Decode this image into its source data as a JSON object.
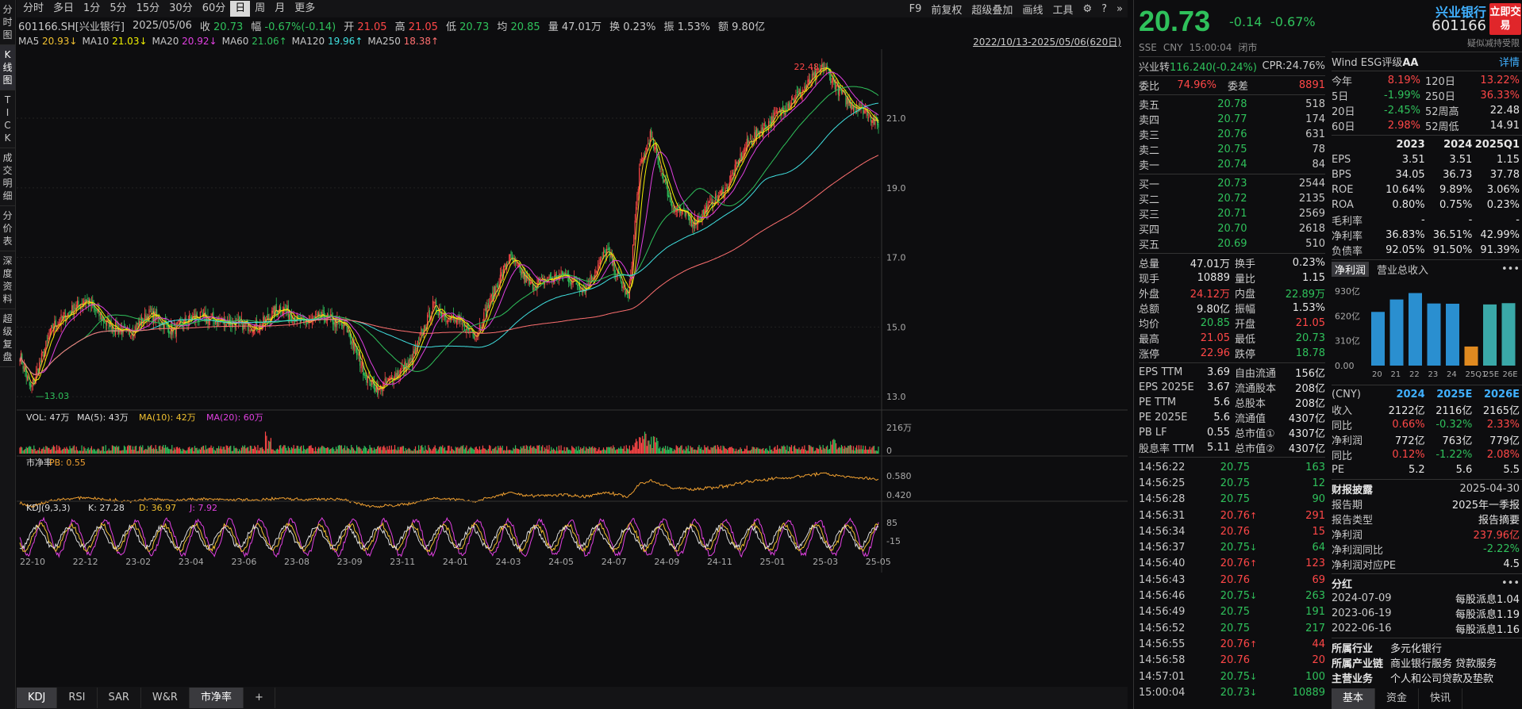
{
  "sidebar": [
    {
      "label": "分时图",
      "chars": [
        "分",
        "时",
        "图"
      ]
    },
    {
      "label": "K线图",
      "chars": [
        "K",
        "线",
        "图"
      ],
      "active": true
    },
    {
      "label": "TICK",
      "chars": [
        "T",
        "I",
        "C",
        "K"
      ]
    },
    {
      "label": "成交明细",
      "chars": [
        "成",
        "交",
        "明",
        "细"
      ]
    },
    {
      "label": "分价表",
      "chars": [
        "分",
        "价",
        "表"
      ]
    },
    {
      "label": "深度资料",
      "chars": [
        "深",
        "度",
        "资",
        "料"
      ]
    },
    {
      "label": "超级复盘",
      "chars": [
        "超",
        "级",
        "复",
        "盘"
      ]
    }
  ],
  "toolbar": {
    "timeframes": [
      "分时",
      "多日",
      "1分",
      "5分",
      "15分",
      "30分",
      "60分",
      "日",
      "周",
      "月",
      "更多"
    ],
    "active_timeframe": "日",
    "right_items": [
      "F9",
      "前复权",
      "超级叠加",
      "画线",
      "工具"
    ]
  },
  "info": {
    "code": "601166.SH[兴业银行]",
    "date": "2025/05/06",
    "close_label": "收",
    "close": "20.73",
    "chg_label": "幅",
    "chg": "-0.67%(-0.14)",
    "open_label": "开",
    "open": "21.05",
    "high_label": "高",
    "high": "21.05",
    "low_label": "低",
    "low": "20.73",
    "avg_label": "均",
    "avg": "20.85",
    "vol_label": "量",
    "vol": "47.01万",
    "turn_label": "换",
    "turn": "0.23%",
    "amp_label": "振",
    "amp": "1.53%",
    "amt_label": "额",
    "amt": "9.80亿"
  },
  "ma": {
    "items": [
      {
        "label": "MA5",
        "value": "20.93↓",
        "color": "#f0c030"
      },
      {
        "label": "MA10",
        "value": "21.03↓",
        "color": "#f0f000"
      },
      {
        "label": "MA20",
        "value": "20.92↓",
        "color": "#e040e0"
      },
      {
        "label": "MA60",
        "value": "21.06↑",
        "color": "#2fc15b"
      },
      {
        "label": "MA120",
        "value": "19.96↑",
        "color": "#40e0e0"
      },
      {
        "label": "MA250",
        "value": "18.38↑",
        "color": "#ff7070"
      }
    ],
    "date_range": "2022/10/13-2025/05/06(620日)"
  },
  "chart_data": [
    {
      "type": "candlestick",
      "panel": "price",
      "y_ticks": [
        "21.0",
        "19.0",
        "17.0",
        "15.0",
        "13.0"
      ],
      "ylim": [
        12.8,
        22.8
      ],
      "max_label": "22.48",
      "min_label": "13.03",
      "x_ticks": [
        "22-10",
        "22-12",
        "23-02",
        "23-04",
        "23-06",
        "23-08",
        "23-09",
        "23-11",
        "24-01",
        "24-03",
        "24-05",
        "24-07",
        "24-09",
        "24-11",
        "25-01",
        "25-03",
        "25-05"
      ],
      "close_keypoints": [
        [
          0,
          14.2
        ],
        [
          10,
          13.2
        ],
        [
          30,
          15.0
        ],
        [
          60,
          15.8
        ],
        [
          80,
          15.1
        ],
        [
          100,
          14.8
        ],
        [
          120,
          15.4
        ],
        [
          140,
          14.9
        ],
        [
          160,
          15.3
        ],
        [
          180,
          15.2
        ],
        [
          200,
          15.1
        ],
        [
          220,
          15.0
        ],
        [
          240,
          15.6
        ],
        [
          260,
          15.1
        ],
        [
          280,
          15.3
        ],
        [
          300,
          15.0
        ],
        [
          320,
          13.5
        ],
        [
          330,
          13.2
        ],
        [
          360,
          14.0
        ],
        [
          380,
          15.6
        ],
        [
          400,
          15.2
        ],
        [
          420,
          14.8
        ],
        [
          450,
          17.0
        ],
        [
          470,
          16.2
        ],
        [
          500,
          16.5
        ],
        [
          520,
          16.1
        ],
        [
          540,
          17.2
        ],
        [
          560,
          15.8
        ],
        [
          570,
          19.5
        ],
        [
          580,
          20.5
        ],
        [
          600,
          18.5
        ],
        [
          620,
          18.0
        ],
        [
          650,
          19.0
        ],
        [
          670,
          20.3
        ],
        [
          700,
          21.2
        ],
        [
          720,
          21.8
        ],
        [
          740,
          22.48
        ],
        [
          760,
          21.5
        ],
        [
          780,
          21.2
        ],
        [
          790,
          20.73
        ]
      ]
    },
    {
      "type": "bar",
      "panel": "volume",
      "label": "VOL: 47万",
      "ma5": "MA(5): 43万",
      "ma10": "MA(10): 42万",
      "ma20": "MA(20): 60万",
      "y_ticks": [
        "216万",
        "0"
      ]
    },
    {
      "type": "line",
      "panel": "pb",
      "label": "市净率",
      "pb": "PB: 0.55",
      "y_ticks": [
        "0.580",
        "0.420"
      ]
    },
    {
      "type": "line",
      "panel": "kdj",
      "label": "KDJ(9,3,3)",
      "k": "K: 27.28",
      "d": "D: 36.97",
      "j": "J: 7.92",
      "y_ticks": [
        "85",
        "-15"
      ]
    }
  ],
  "bottom_tabs": [
    "KDJ",
    "RSI",
    "SAR",
    "W&R",
    "市净率",
    "+"
  ],
  "quote": {
    "price": "20.73",
    "change": "-0.14",
    "pct": "-0.67%",
    "name": "兴业银行",
    "code": "601166",
    "trade_btn": "立即交易",
    "exch": "SSE",
    "ccy": "CNY",
    "time": "15:00:04",
    "status": "闭市",
    "tags": "疑似减持受限",
    "conv_bond": "兴业转",
    "conv_val": "116.240(-0.24%)",
    "cpr": "CPR:24.76%",
    "webi_label": "委比",
    "webi": "74.96%",
    "wecha_label": "委差",
    "wecha": "8891",
    "asks": [
      {
        "label": "卖五",
        "price": "20.78",
        "vol": "518"
      },
      {
        "label": "卖四",
        "price": "20.77",
        "vol": "174"
      },
      {
        "label": "卖三",
        "price": "20.76",
        "vol": "631"
      },
      {
        "label": "卖二",
        "price": "20.75",
        "vol": "78"
      },
      {
        "label": "卖一",
        "price": "20.74",
        "vol": "84"
      }
    ],
    "bids": [
      {
        "label": "买一",
        "price": "20.73",
        "vol": "2544"
      },
      {
        "label": "买二",
        "price": "20.72",
        "vol": "2135"
      },
      {
        "label": "买三",
        "price": "20.71",
        "vol": "2569"
      },
      {
        "label": "买四",
        "price": "20.70",
        "vol": "2618"
      },
      {
        "label": "买五",
        "price": "20.69",
        "vol": "510"
      }
    ],
    "stats": [
      [
        "总量",
        "47.01万",
        "换手",
        "0.23%"
      ],
      [
        "现手",
        "10889",
        "量比",
        "1.15"
      ],
      [
        "外盘",
        "24.12万",
        "内盘",
        "22.89万"
      ],
      [
        "总额",
        "9.80亿",
        "振幅",
        "1.53%"
      ],
      [
        "均价",
        "20.85",
        "开盘",
        "21.05"
      ],
      [
        "最高",
        "21.05",
        "最低",
        "20.73"
      ],
      [
        "涨停",
        "22.96",
        "跌停",
        "18.78"
      ]
    ],
    "fund": [
      [
        "EPS TTM",
        "3.69",
        "自由流通",
        "156亿"
      ],
      [
        "EPS 2025E",
        "3.67",
        "流通股本",
        "208亿"
      ],
      [
        "PE TTM",
        "5.6",
        "总股本",
        "208亿"
      ],
      [
        "PE 2025E",
        "5.6",
        "流通值",
        "4307亿"
      ],
      [
        "PB LF",
        "0.55",
        "总市值①",
        "4307亿"
      ],
      [
        "股息率 TTM",
        "5.11",
        "总市值②",
        "4307亿"
      ]
    ],
    "ticks": [
      {
        "time": "14:56:22",
        "price": "20.75",
        "dir": "",
        "vol": "163",
        "c": "dn"
      },
      {
        "time": "14:56:25",
        "price": "20.75",
        "dir": "",
        "vol": "12",
        "c": "dn"
      },
      {
        "time": "14:56:28",
        "price": "20.75",
        "dir": "",
        "vol": "90",
        "c": "dn"
      },
      {
        "time": "14:56:31",
        "price": "20.76",
        "dir": "↑",
        "vol": "291",
        "c": "up"
      },
      {
        "time": "14:56:34",
        "price": "20.76",
        "dir": "",
        "vol": "15",
        "c": "up"
      },
      {
        "time": "14:56:37",
        "price": "20.75",
        "dir": "↓",
        "vol": "64",
        "c": "dn"
      },
      {
        "time": "14:56:40",
        "price": "20.76",
        "dir": "↑",
        "vol": "123",
        "c": "up"
      },
      {
        "time": "14:56:43",
        "price": "20.76",
        "dir": "",
        "vol": "69",
        "c": "up"
      },
      {
        "time": "14:56:46",
        "price": "20.75",
        "dir": "↓",
        "vol": "263",
        "c": "dn"
      },
      {
        "time": "14:56:49",
        "price": "20.75",
        "dir": "",
        "vol": "191",
        "c": "dn"
      },
      {
        "time": "14:56:52",
        "price": "20.75",
        "dir": "",
        "vol": "217",
        "c": "dn"
      },
      {
        "time": "14:56:55",
        "price": "20.76",
        "dir": "↑",
        "vol": "44",
        "c": "up"
      },
      {
        "time": "14:56:58",
        "price": "20.76",
        "dir": "",
        "vol": "20",
        "c": "up"
      },
      {
        "time": "14:57:01",
        "price": "20.75",
        "dir": "↓",
        "vol": "100",
        "c": "dn"
      },
      {
        "time": "15:00:04",
        "price": "20.73",
        "dir": "↓",
        "vol": "10889",
        "c": "dn"
      }
    ]
  },
  "f10": {
    "wind_esg": "Wind ESG评级",
    "esg_grade": "AA",
    "detail": "详情",
    "returns": [
      [
        "今年",
        "8.19%",
        "120日",
        "13.22%"
      ],
      [
        "5日",
        "-1.99%",
        "250日",
        "36.33%"
      ],
      [
        "20日",
        "-2.45%",
        "52周高",
        "22.48"
      ],
      [
        "60日",
        "2.98%",
        "52周低",
        "14.91"
      ]
    ],
    "fin_header": [
      "",
      "2023",
      "2024",
      "2025Q1"
    ],
    "fin": [
      [
        "EPS",
        "3.51",
        "3.51",
        "1.15"
      ],
      [
        "BPS",
        "34.05",
        "36.73",
        "37.78"
      ],
      [
        "ROE",
        "10.64%",
        "9.89%",
        "3.06%"
      ],
      [
        "ROA",
        "0.80%",
        "0.75%",
        "0.23%"
      ],
      [
        "毛利率",
        "-",
        "-",
        "-"
      ],
      [
        "净利率",
        "36.83%",
        "36.51%",
        "42.99%"
      ],
      [
        "负债率",
        "92.05%",
        "91.50%",
        "91.39%"
      ]
    ],
    "tab_profit": "净利润",
    "tab_rev": "营业总收入",
    "bar_chart": {
      "type": "bar",
      "y_ticks": [
        "930亿",
        "620亿",
        "310亿",
        "0.00"
      ],
      "categories": [
        "20",
        "21",
        "22",
        "23",
        "24",
        "25Q1",
        "25E",
        "26E"
      ],
      "values": [
        670,
        825,
        905,
        775,
        772,
        238,
        763,
        779
      ],
      "colors": [
        "#2a8fd0",
        "#2a8fd0",
        "#2a8fd0",
        "#2a8fd0",
        "#2a8fd0",
        "#e08a20",
        "#3aa8a8",
        "#3aa8a8"
      ]
    },
    "forecast_header": [
      "(CNY)",
      "2024",
      "2025E",
      "2026E"
    ],
    "forecast": [
      [
        "收入",
        "2122亿",
        "2116亿",
        "2165亿"
      ],
      [
        "同比",
        "0.66%",
        "-0.32%",
        "2.33%"
      ],
      [
        "净利润",
        "772亿",
        "763亿",
        "779亿"
      ],
      [
        "同比",
        "0.12%",
        "-1.22%",
        "2.08%"
      ],
      [
        "PE",
        "5.2",
        "5.6",
        "5.5"
      ]
    ],
    "disclosure_title": "财报披露",
    "disclosure_date": "2025-04-30",
    "disclosure": [
      [
        "报告期",
        "2025年一季报"
      ],
      [
        "报告类型",
        "报告摘要"
      ],
      [
        "净利润",
        "237.96亿"
      ],
      [
        "净利润同比",
        "-2.22%"
      ],
      [
        "净利润对应PE",
        "4.5"
      ]
    ],
    "dividend_title": "分红",
    "dividends": [
      [
        "2024-07-09",
        "每股派息1.04"
      ],
      [
        "2023-06-19",
        "每股派息1.19"
      ],
      [
        "2022-06-16",
        "每股派息1.16"
      ]
    ],
    "industry": [
      [
        "所属行业",
        "多元化银行"
      ],
      [
        "所属产业链",
        "商业银行服务 贷款服务"
      ],
      [
        "主营业务",
        "个人和公司贷款及垫款"
      ]
    ],
    "bottom_tabs": [
      "基本",
      "资金",
      "快讯"
    ]
  }
}
